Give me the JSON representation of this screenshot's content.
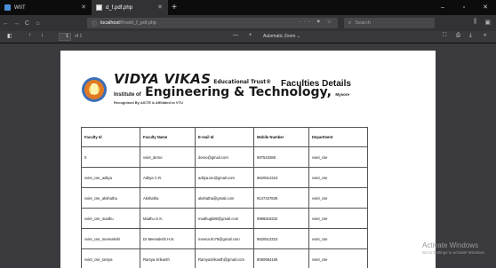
{
  "tabs": [
    {
      "label": "WIIT",
      "favicon": "site-icon"
    },
    {
      "label": "d_f.pdf.php",
      "favicon": "page-icon",
      "active": true
    }
  ],
  "window_controls": {
    "minimize": "–",
    "maximize": "▫",
    "close": "✕"
  },
  "nav": {
    "back": "←",
    "forward": "→",
    "reload": "C",
    "home": "⌂",
    "url_host": "localhost",
    "url_path": "/f/vwiit_f_pdf.php",
    "search_placeholder": "Search"
  },
  "pdf_toolbar": {
    "page_number": "1",
    "page_of": "of 1",
    "zoom_out": "—",
    "zoom_in": "+",
    "zoom_label": "Automatic Zoom ⌄"
  },
  "document": {
    "brand_name": "VIDYA VIKAS",
    "brand_trust": "Educational Trust®",
    "brand_line2_prefix": "Institute of",
    "brand_line2_main": "Engineering & Technology,",
    "brand_line2_city": "Mysore",
    "brand_line3": "Recognised By AICTE & Affiliated to VTU",
    "title": "Faculties Details",
    "table": {
      "headers": [
        "Faculty Id",
        "Faculty Name",
        "E-mail Id",
        "Mobile Number",
        "Department"
      ],
      "rows": [
        [
          "0",
          "vviet_demo",
          "demo@gmail.com",
          "987543288",
          "vviet_cse"
        ],
        [
          "vviet_cse_aditya",
          "Aditya C.R.",
          "aditya.ise@gmail.com",
          "9620512323",
          "vviet_cse"
        ],
        [
          "vviet_cse_akshatha",
          "Akshatha",
          "akshatha@gmail.com",
          "9147437839",
          "vviet_cse"
        ],
        [
          "vviet_cse_madhu",
          "Madhu G.K.",
          "madhugk99@gmail.com",
          "9986819332",
          "vviet_cse"
        ],
        [
          "vviet_cse_meenakshi",
          "Dr Meenakshi H.N.",
          "meena.hn76@gmail.com",
          "9620512323",
          "vviet_cse"
        ],
        [
          "vviet_cse_ramya",
          "Ramya Srikanth",
          "RamyaSrikanth@gmail.com",
          "8050684166",
          "vviet_cse"
        ]
      ]
    }
  },
  "watermark": {
    "line1": "Activate Windows",
    "line2": "Go to Settings to activate Windows."
  }
}
